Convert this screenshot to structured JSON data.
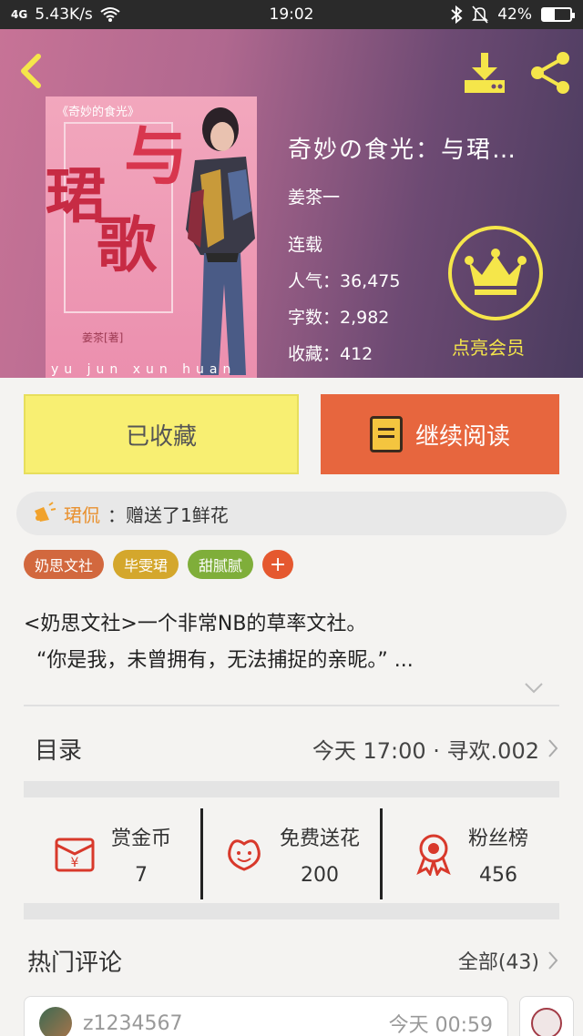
{
  "status_bar": {
    "network": "4G",
    "speed": "5.43K/s",
    "time": "19:02",
    "battery": "42%",
    "battery_level": 0.42
  },
  "book": {
    "title": "奇妙の食光：与珺…",
    "author": "姜茶一",
    "status": "连载",
    "popularity": "人气：36,475",
    "word_count": "字数：2,982",
    "favorites": "收藏：412",
    "vip_label": "点亮会员",
    "cover": {
      "top_text": "《奇妙的食光》",
      "big1": "与",
      "big2": "珺",
      "big3": "歌",
      "author_text": "姜茶[著]",
      "pinyin": "yu jun xun huan"
    }
  },
  "actions": {
    "favorite_label": "已收藏",
    "read_label": "继续阅读"
  },
  "flower_notice": {
    "user": "珺侃",
    "text": "：赠送了1鲜花"
  },
  "tags": [
    "奶思文社",
    "毕雯珺",
    "甜腻腻"
  ],
  "tag_add": "+",
  "description": {
    "line1": "<奶思文社>一个非常NB的草率文社。",
    "line2": "“你是我，未曾拥有，无法捕捉的亲昵。”  ..."
  },
  "toc": {
    "label": "目录",
    "latest": "今天 17:00 · 寻欢.002"
  },
  "stats": [
    {
      "name": "赏金币",
      "value": "7",
      "icon": "red-envelope-icon"
    },
    {
      "name": "免费送花",
      "value": "200",
      "icon": "flower-icon"
    },
    {
      "name": "粉丝榜",
      "value": "456",
      "icon": "medal-icon"
    }
  ],
  "comments": {
    "label": "热门评论",
    "all": "全部(43)"
  },
  "comment_preview": {
    "user": "z1234567",
    "time": "今天 00:59"
  },
  "colors": {
    "favorite_btn": "#f8ef72",
    "read_btn": "#e7663e",
    "vip": "#f5e64a"
  }
}
